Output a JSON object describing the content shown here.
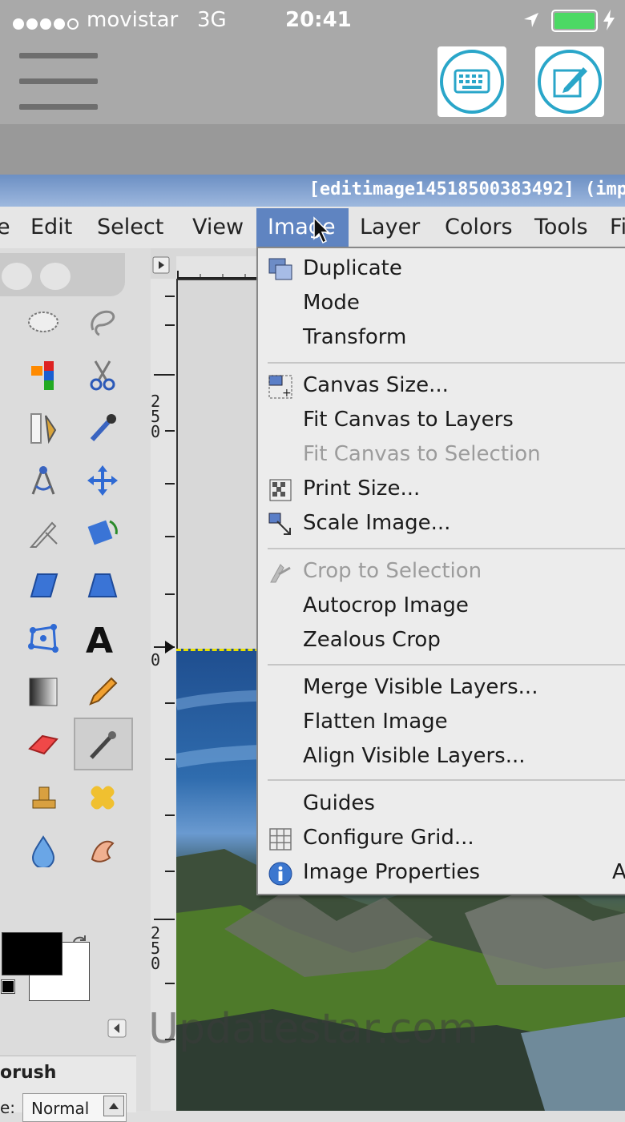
{
  "status_bar": {
    "carrier": "movistar",
    "network": "3G",
    "time": "20:41"
  },
  "gimp": {
    "window_title": "[editimage14518500383492] (imp",
    "menubar": [
      "e",
      "Edit",
      "Select",
      "View",
      "Image",
      "Layer",
      "Colors",
      "Tools",
      "Fi"
    ],
    "active_menu": "Image",
    "image_menu": {
      "items": [
        {
          "label": "Duplicate",
          "icon": "duplicate-icon",
          "disabled": false
        },
        {
          "label": "Mode",
          "disabled": false
        },
        {
          "label": "Transform",
          "disabled": false
        },
        {
          "label": "Canvas Size...",
          "icon": "canvas-size-icon",
          "disabled": false
        },
        {
          "label": "Fit Canvas to Layers",
          "disabled": false
        },
        {
          "label": "Fit Canvas to Selection",
          "disabled": true
        },
        {
          "label": "Print Size...",
          "icon": "print-size-icon",
          "disabled": false
        },
        {
          "label": "Scale Image...",
          "icon": "scale-image-icon",
          "disabled": false
        },
        {
          "label": "Crop to Selection",
          "icon": "crop-icon",
          "disabled": true
        },
        {
          "label": "Autocrop Image",
          "disabled": false
        },
        {
          "label": "Zealous Crop",
          "disabled": false
        },
        {
          "label": "Merge Visible Layers...",
          "disabled": false
        },
        {
          "label": "Flatten Image",
          "disabled": false
        },
        {
          "label": "Align Visible Layers...",
          "disabled": false
        },
        {
          "label": "Guides",
          "disabled": false
        },
        {
          "label": "Configure Grid...",
          "icon": "grid-icon",
          "disabled": false
        },
        {
          "label": "Image Properties",
          "icon": "info-icon",
          "disabled": false,
          "shortcut": "A"
        }
      ]
    },
    "ruler_labels": {
      "v_top": "250",
      "v_zero": "0",
      "v_bottom": "250"
    },
    "tool_options": {
      "title": "orush",
      "mode_label": "e:",
      "mode_value": "Normal"
    }
  },
  "watermark": "Updatestar.com",
  "colors": {
    "accent": "#5f84c1",
    "title_bar": "#7f9fd0",
    "ios_chrome": "#a9a9a9"
  }
}
